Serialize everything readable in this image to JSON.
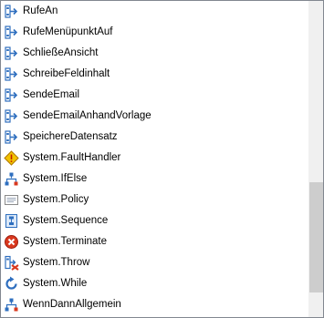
{
  "list": {
    "items": [
      {
        "label": "RufeAn",
        "icon": "activity-arrow-icon"
      },
      {
        "label": "RufeMenüpunktAuf",
        "icon": "activity-arrow-icon"
      },
      {
        "label": "SchließeAnsicht",
        "icon": "activity-arrow-icon"
      },
      {
        "label": "SchreibeFeldinhalt",
        "icon": "activity-arrow-icon"
      },
      {
        "label": "SendeEmail",
        "icon": "activity-arrow-icon"
      },
      {
        "label": "SendeEmailAnhandVorlage",
        "icon": "activity-arrow-icon"
      },
      {
        "label": "SpeichereDatensatz",
        "icon": "activity-arrow-icon"
      },
      {
        "label": "System.FaultHandler",
        "icon": "warning-diamond-icon"
      },
      {
        "label": "System.IfElse",
        "icon": "branch-icon"
      },
      {
        "label": "System.Policy",
        "icon": "policy-list-icon"
      },
      {
        "label": "System.Sequence",
        "icon": "sequence-icon"
      },
      {
        "label": "System.Terminate",
        "icon": "terminate-icon"
      },
      {
        "label": "System.Throw",
        "icon": "throw-icon"
      },
      {
        "label": "System.While",
        "icon": "loop-icon"
      },
      {
        "label": "WennDannAllgemein",
        "icon": "branch-icon"
      }
    ]
  },
  "scrollbar": {
    "position_fraction": 0.88,
    "visible_fraction": 0.35
  },
  "colors": {
    "border": "#828790",
    "scroll_track": "#f0f0f0",
    "scroll_thumb": "#cdcdcd",
    "icon_blue": "#2f6fbf",
    "warning_yellow": "#f2c200",
    "terminate_red": "#d9381e"
  }
}
